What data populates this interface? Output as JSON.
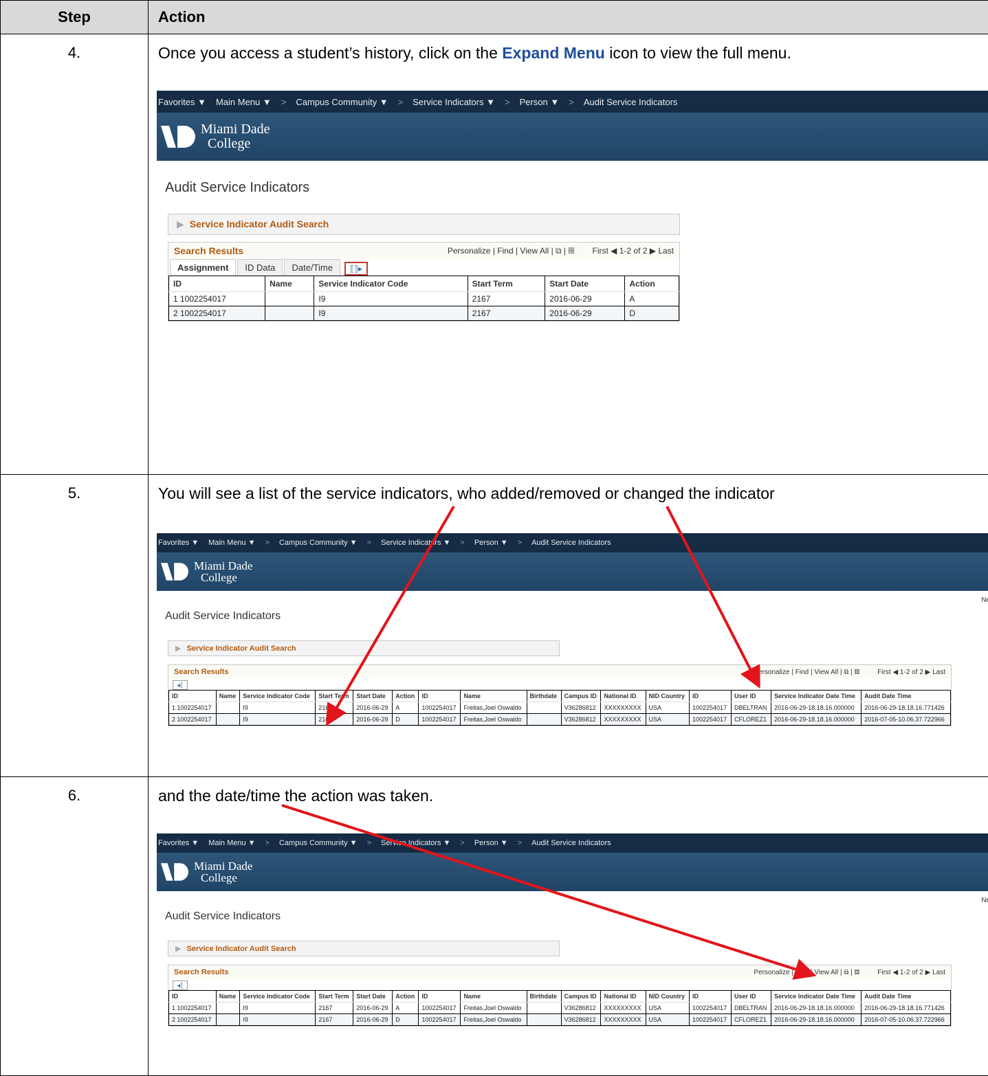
{
  "table": {
    "col_step": "Step",
    "col_action": "Action"
  },
  "steps": [
    {
      "number": "4.",
      "instruction_before": "Once you access a student’s history, click on the ",
      "instruction_bold": "Expand Menu",
      "instruction_after": " icon to view the full menu."
    },
    {
      "number": "5.",
      "instruction": "You will see a list of the service indicators, who added/removed or changed the indicator"
    },
    {
      "number": "6.",
      "instruction": "and the date/time the action was taken."
    }
  ],
  "app": {
    "nav": {
      "favorites": "Favorites ▼",
      "main_menu": "Main Menu ▼",
      "crumb1": "Campus Community ▼",
      "crumb2": "Service Indicators ▼",
      "crumb3": "Person ▼",
      "crumb4": "Audit Service Indicators",
      "sep": ">"
    },
    "logo_line1": "Miami Dade",
    "logo_line2": "College",
    "page_title": "Audit Service Indicators",
    "audit_search": "Service Indicator Audit Search",
    "results_title": "Search Results",
    "results_links": "Personalize | Find | View All | ⧉ | ▦",
    "pager": "First ◀ 1-2 of 2 ▶ Last",
    "tabs": [
      "Assignment",
      "ID Data",
      "Date/Time"
    ],
    "expand_glyph": "⟦⟧▸",
    "ne_text": "Ne",
    "columns_collapsed": [
      "ID",
      "Name",
      "Service Indicator Code",
      "Start Term",
      "Start Date",
      "Action"
    ],
    "rows_collapsed": [
      [
        "1 1002254017",
        "",
        "I9",
        "2167",
        "2016-06-29",
        "A"
      ],
      [
        "2 1002254017",
        "",
        "I9",
        "2167",
        "2016-06-29",
        "D"
      ]
    ],
    "columns_full": [
      "ID",
      "Name",
      "Service Indicator Code",
      "Start Term",
      "Start Date",
      "Action",
      "ID",
      "Name",
      "Birthdate",
      "Campus ID",
      "National ID",
      "NID Country",
      "ID",
      "User ID",
      "Service Indicator Date Time",
      "Audit Date Time"
    ],
    "rows_full": [
      [
        "1 1002254017",
        "",
        "I9",
        "2167",
        "2016-06-29",
        "A",
        "1002254017",
        "Freitas,Joel Oswaldo",
        "",
        "V36286812",
        "XXXXXXXXX",
        "USA",
        "1002254017",
        "DBELTRAN",
        "2016-06-29-18.18.16.000000",
        "2016-06-29-18.18.16.771426"
      ],
      [
        "2 1002254017",
        "",
        "I9",
        "2167",
        "2016-06-29",
        "D",
        "1002254017",
        "Freitas,Joel Oswaldo",
        "",
        "V36286812",
        "XXXXXXXXX",
        "USA",
        "1002254017",
        "CFLOREZ1",
        "2016-06-29-18.18.16.000000",
        "2016-07-05-10.06.37.722966"
      ]
    ]
  },
  "colors": {
    "nav_bg": "#152c44",
    "banner_bg": "#1f4466",
    "accent_orange": "#b35b12",
    "annotation_red": "#e3141b",
    "link_blue": "#1f4e9a"
  }
}
